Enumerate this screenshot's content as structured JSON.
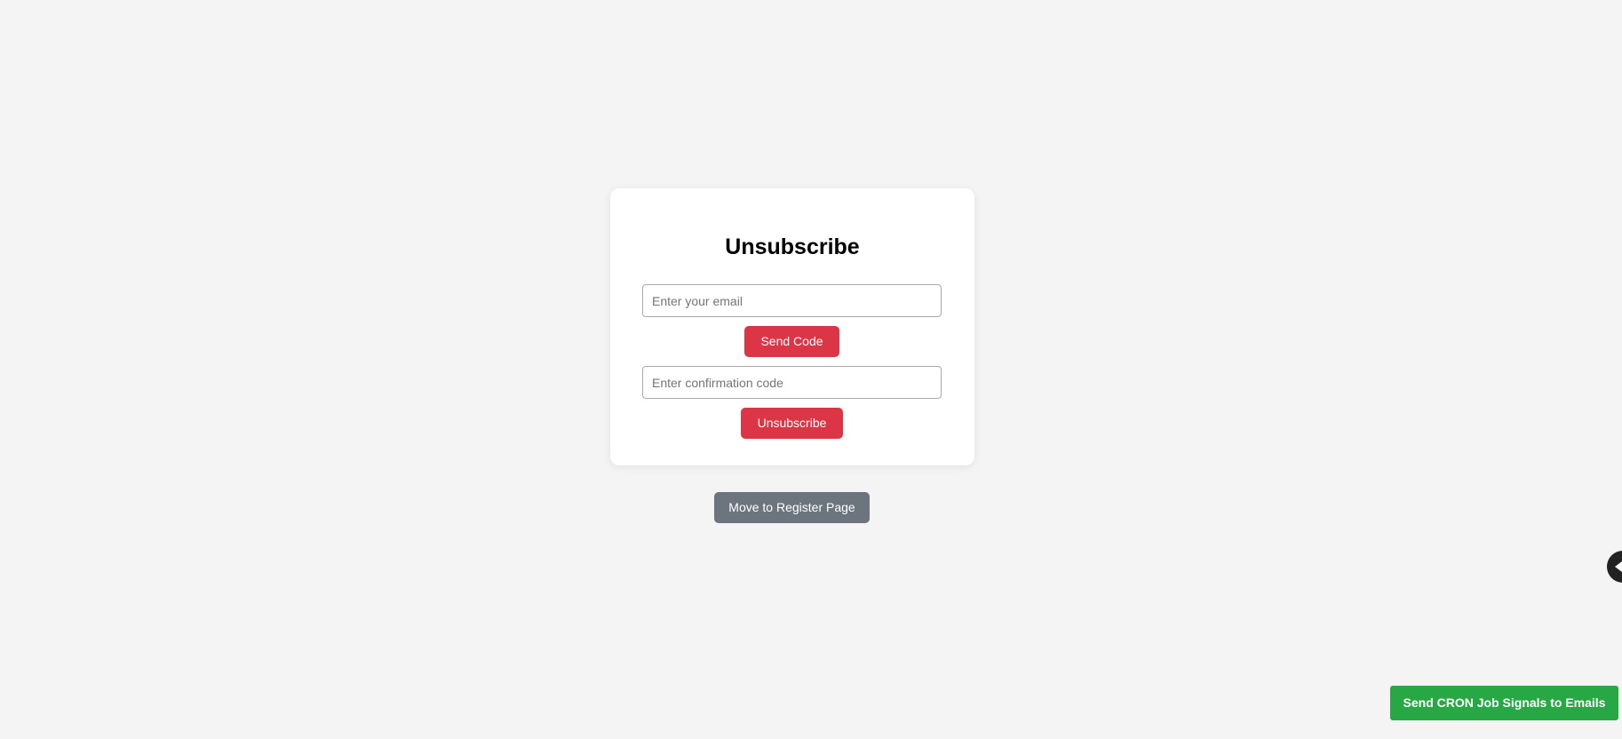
{
  "card": {
    "title": "Unsubscribe",
    "email_placeholder": "Enter your email",
    "email_value": "",
    "send_code_label": "Send Code",
    "code_placeholder": "Enter confirmation code",
    "code_value": "",
    "unsubscribe_label": "Unsubscribe"
  },
  "nav": {
    "register_label": "Move to Register Page"
  },
  "footer": {
    "cron_label": "Send CRON Job Signals to Emails"
  },
  "widget": {
    "icon": "chevron-left-icon"
  },
  "colors": {
    "background": "#f4f4f4",
    "danger": "#dc3545",
    "secondary": "#6c757d",
    "success": "#28a745"
  }
}
